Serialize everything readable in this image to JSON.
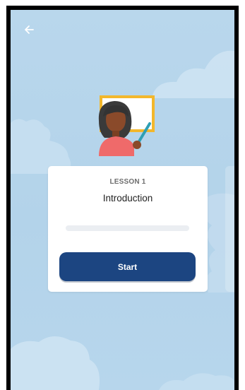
{
  "header": {
    "back_icon": "arrow-left-icon"
  },
  "lesson": {
    "number_label": "LESSON 1",
    "title": "Introduction",
    "progress": 0,
    "illustration_icon": "teacher-at-whiteboard-icon"
  },
  "actions": {
    "start_label": "Start"
  },
  "colors": {
    "background": "#b9d7ec",
    "card": "#ffffff",
    "button": "#1c4581",
    "progress_track": "#ebeef2",
    "board_frame": "#f2b72c"
  }
}
